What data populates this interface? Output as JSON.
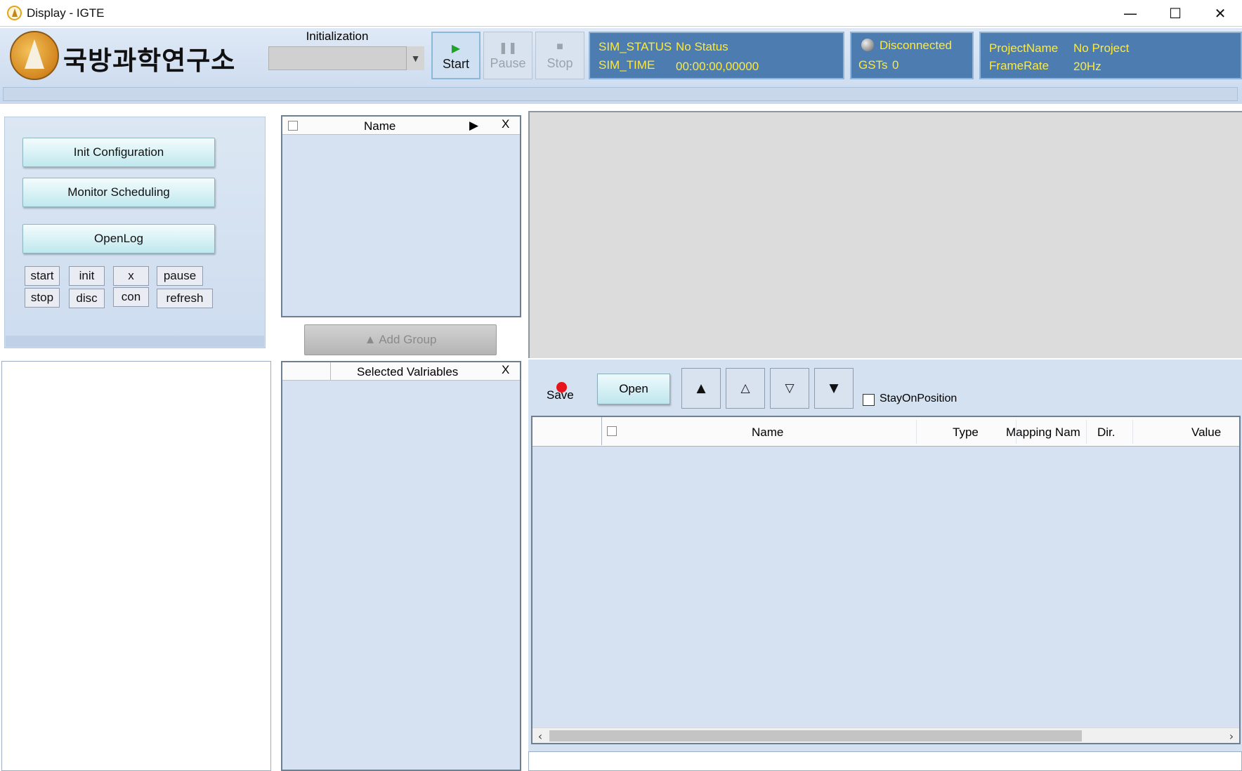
{
  "window": {
    "title": "Display - IGTE",
    "controls": {
      "minimize": "—",
      "maximize": "☐",
      "close": "✕"
    }
  },
  "header": {
    "logo_text": "국방과학연구소",
    "init_label": "Initialization",
    "init_value": "",
    "toolbar": {
      "start_label": "Start",
      "pause_label": "Pause",
      "stop_label": "Stop"
    },
    "status": {
      "sim_status_label": "SIM_STATUS",
      "sim_status_value": "No Status",
      "sim_time_label": "SIM_TIME",
      "sim_time_value": "00:00:00,00000"
    },
    "connection": {
      "state": "Disconnected",
      "gsts_label": "GSTs",
      "gsts_value": "0"
    },
    "project": {
      "project_name_label": "ProjectName",
      "project_name_value": "No Project",
      "frame_rate_label": "FrameRate",
      "frame_rate_value": "20Hz"
    }
  },
  "control_panel": {
    "init_configuration": "Init Configuration",
    "monitor_scheduling": "Monitor Scheduling",
    "open_log": "OpenLog",
    "small_buttons": {
      "start": "start",
      "init": "init",
      "x": "x",
      "pause": "pause",
      "stop": "stop",
      "disc": "disc",
      "con": "con",
      "refresh": "refresh"
    }
  },
  "name_list": {
    "column_name": "Name",
    "play_glyph": "▶",
    "close_glyph": "X"
  },
  "add_group": "▲ Add Group",
  "selected_panel": {
    "header": "Selected Valriables",
    "close_glyph": "X"
  },
  "variable_toolbar": {
    "save_label": "Save",
    "open_label": "Open",
    "move_top": "▲",
    "move_up": "△",
    "move_down": "▽",
    "move_bottom": "▼",
    "stay_on_position": "StayOnPosition"
  },
  "variable_grid": {
    "columns": [
      "Name",
      "Type",
      "Mapping Nam",
      "Dir.",
      "Value"
    ],
    "rows": []
  },
  "colors": {
    "status_panel_bg": "#4d7db0",
    "status_text": "#ffe93a",
    "panel_bg": "#d6e2f1",
    "start_icon": "#1fa32a",
    "save_dot": "#e8141c"
  }
}
